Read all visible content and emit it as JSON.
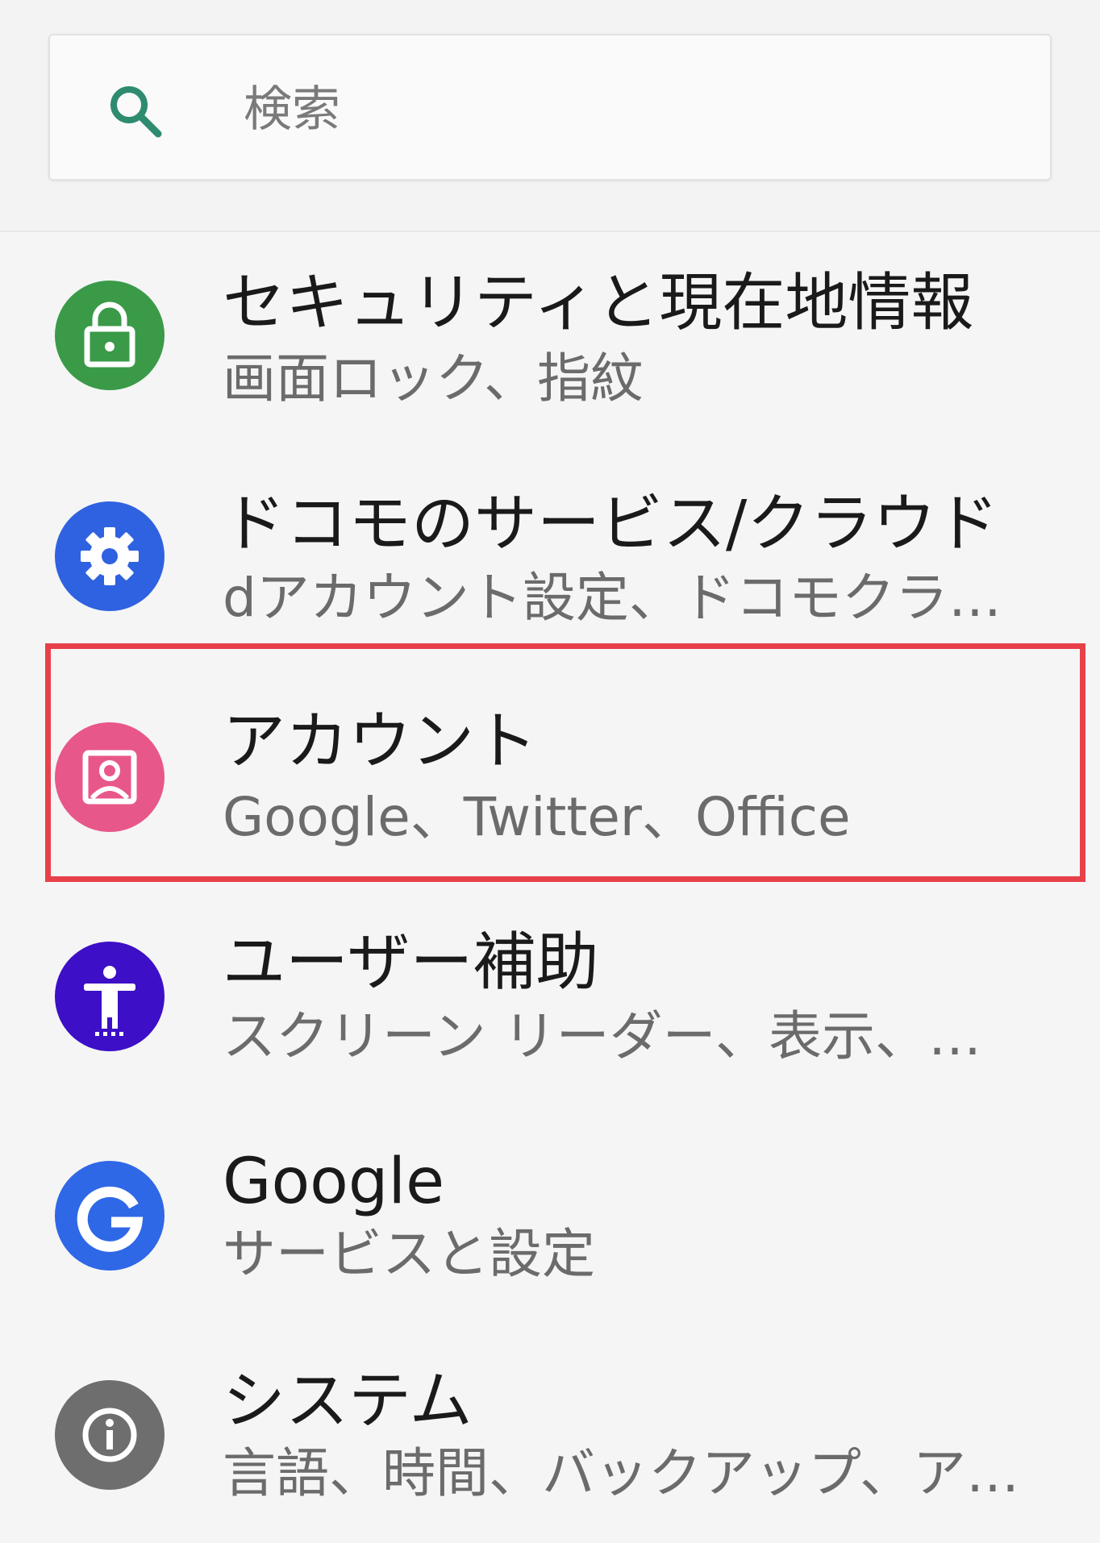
{
  "search": {
    "placeholder": "検索",
    "icon": "search-icon",
    "icon_color": "#2e8b70"
  },
  "settings": {
    "items": [
      {
        "id": "security",
        "title": "セキュリティと現在地情報",
        "subtitle": "画面ロック、指紋",
        "icon": "lock-icon",
        "icon_bg": "#3a9a48"
      },
      {
        "id": "docomo",
        "title": "ドコモのサービス/クラウド",
        "subtitle": "dアカウント設定、ドコモクラ…",
        "icon": "gear-icon",
        "icon_bg": "#2f62e0"
      },
      {
        "id": "accounts",
        "title": "アカウント",
        "subtitle": "Google、Twitter、Office",
        "icon": "account-box-icon",
        "icon_bg": "#e8578a",
        "highlighted": true
      },
      {
        "id": "accessibility",
        "title": "ユーザー補助",
        "subtitle": "スクリーン リーダー、表示、…",
        "icon": "accessibility-icon",
        "icon_bg": "#3d0fc6"
      },
      {
        "id": "google",
        "title": "Google",
        "subtitle": "サービスと設定",
        "icon": "google-g-icon",
        "icon_bg": "#2f68e6"
      },
      {
        "id": "system",
        "title": "システム",
        "subtitle": "言語、時間、バックアップ、ア…",
        "icon": "info-icon",
        "icon_bg": "#6e6e6e"
      }
    ]
  },
  "highlight_color": "#e8404a"
}
